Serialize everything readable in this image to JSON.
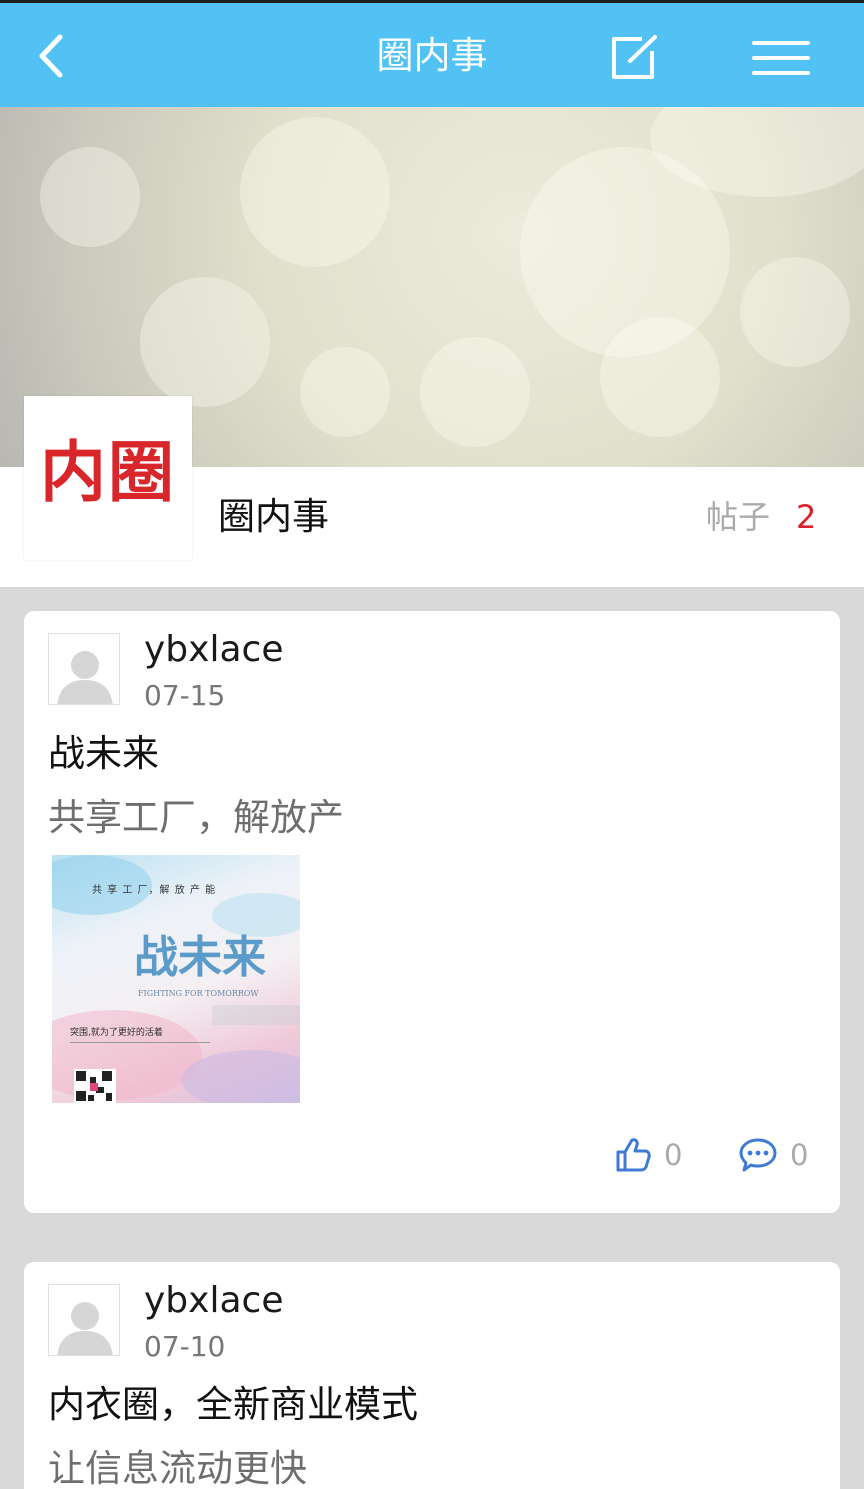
{
  "header": {
    "title": "圈内事",
    "back_icon": "chevron-left-icon",
    "edit_icon": "edit-icon",
    "menu_icon": "menu-icon"
  },
  "circle": {
    "logo_text": "内圈",
    "name": "圈内事",
    "posts_label": "帖子",
    "posts_count": "2"
  },
  "posts": [
    {
      "username": "ybxlace",
      "date": "07-15",
      "title": "战未来",
      "summary": "共享工厂，解放产",
      "image": {
        "top_text": "共 享 工 厂，解 放 产 能",
        "headline": "战未来",
        "subtitle": "FIGHTING FOR TOMORROW",
        "caption": "突围,就为了更好的活着"
      },
      "likes": "0",
      "comments": "0"
    },
    {
      "username": "ybxlace",
      "date": "07-10",
      "title": "内衣圈，全新商业模式",
      "summary": "让信息流动更快"
    }
  ],
  "colors": {
    "topbar": "#52c2f5",
    "accent_red": "#d9232c",
    "icon_blue": "#3f7bd5"
  }
}
